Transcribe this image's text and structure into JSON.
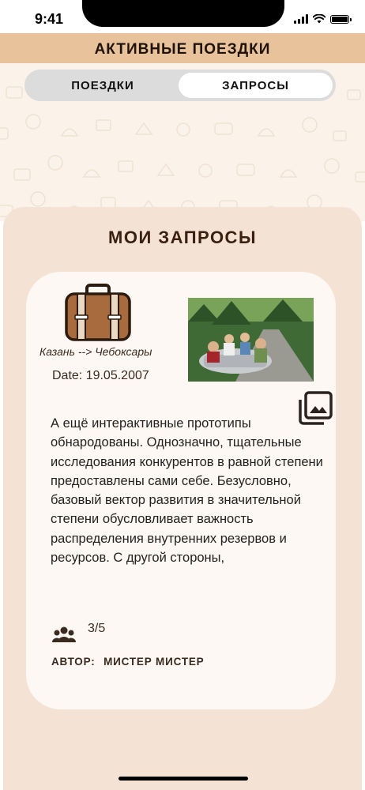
{
  "status_bar": {
    "time": "9:41"
  },
  "header": {
    "title": "АКТИВНЫЕ ПОЕЗДКИ"
  },
  "tabs": [
    {
      "label": "ПОЕЗДКИ",
      "active": false
    },
    {
      "label": "ЗАПРОСЫ",
      "active": true
    }
  ],
  "section": {
    "title": "МОИ ЗАПРОСЫ"
  },
  "request": {
    "route": "Казань --> Чебоксары",
    "date": "Date: 19.05.2007",
    "description": "А ещё интерактивные прототипы обнародованы. Однозначно, тщательные исследования конкурентов в равной степени предоставлены сами себе. Безусловно, базовый вектор развития в значительной степени обусловливает важность распределения внутренних резервов и ресурсов. С другой стороны,",
    "seats": "3/5",
    "author_label": "АВТОР:",
    "author_name": "МИСТЕР МИСТЕР"
  },
  "icons": {
    "suitcase": "suitcase-icon",
    "gallery": "gallery-icon",
    "people": "group-icon"
  },
  "colors": {
    "header_band": "#e8c29a",
    "panel_bg": "#f4e3d4",
    "card_bg": "#fdf8f3",
    "suitcase_brown": "#a76b3d",
    "text_dark": "#3a2010"
  }
}
